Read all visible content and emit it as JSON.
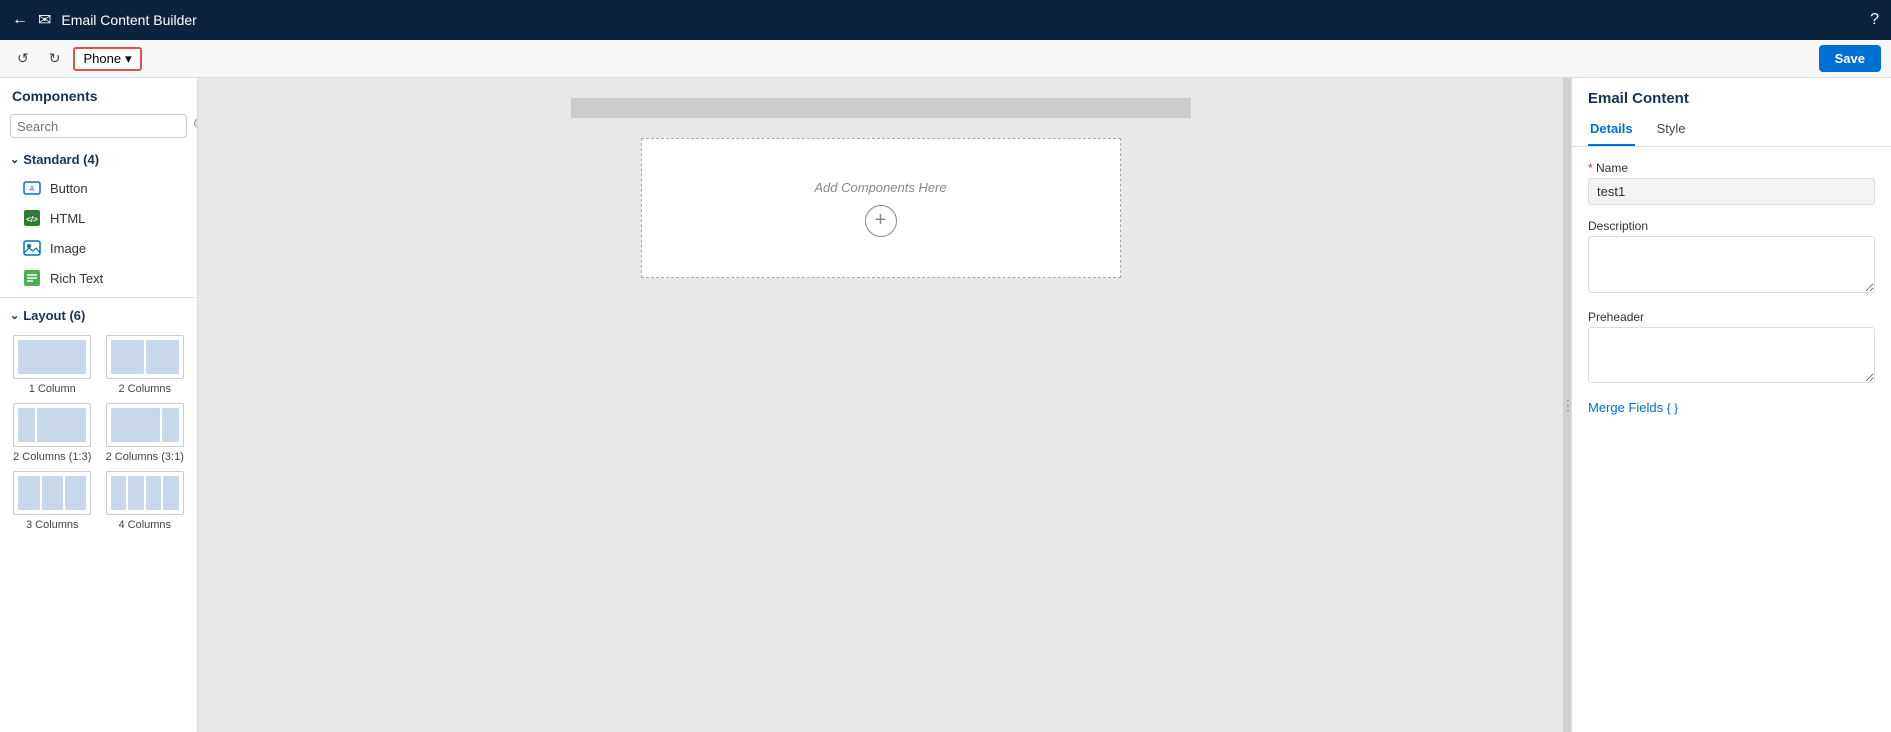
{
  "topNav": {
    "backIcon": "←",
    "mailIcon": "✉",
    "title": "Email Content Builder",
    "helpIcon": "?"
  },
  "toolbar": {
    "undoIcon": "↺",
    "redoIcon": "↻",
    "phoneLabel": "Phone",
    "chevron": "▾",
    "saveLabel": "Save"
  },
  "sidebar": {
    "title": "Components",
    "searchPlaceholder": "Search",
    "standardSection": "Standard (4)",
    "standardItems": [
      {
        "label": "Button",
        "iconType": "button"
      },
      {
        "label": "HTML",
        "iconType": "html"
      },
      {
        "label": "Image",
        "iconType": "image"
      },
      {
        "label": "Rich Text",
        "iconType": "richtext"
      }
    ],
    "layoutSection": "Layout (6)",
    "layoutItems": [
      {
        "label": "1 Column",
        "cols": [
          1
        ]
      },
      {
        "label": "2 Columns",
        "cols": [
          2
        ]
      },
      {
        "label": "2 Columns (1:3)",
        "cols": [
          1,
          3
        ]
      },
      {
        "label": "2 Columns (3:1)",
        "cols": [
          3,
          1
        ]
      },
      {
        "label": "3 Columns",
        "cols": [
          1,
          1,
          1
        ]
      },
      {
        "label": "4 Columns",
        "cols": [
          1,
          1,
          1,
          1
        ]
      }
    ]
  },
  "canvas": {
    "dropZoneText": "Add Components Here",
    "addIcon": "+"
  },
  "rightPanel": {
    "title": "Email Content",
    "tabs": [
      {
        "label": "Details",
        "active": true
      },
      {
        "label": "Style",
        "active": false
      }
    ],
    "nameLabel": "Name",
    "nameValue": "test1",
    "descriptionLabel": "Description",
    "descriptionValue": "",
    "preheaderLabel": "Preheader",
    "preheaderValue": "",
    "mergeFieldsLabel": "Merge Fields",
    "mergeFieldsBraces": "{ }"
  }
}
